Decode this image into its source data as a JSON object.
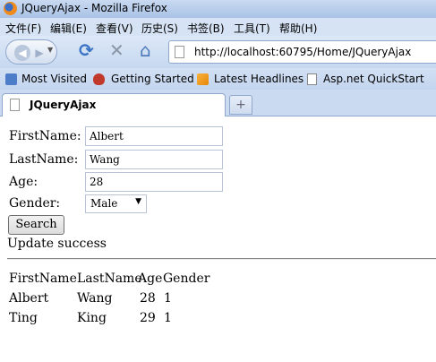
{
  "window": {
    "title": "JQueryAjax - Mozilla Firefox"
  },
  "menu": [
    "文件(F)",
    "编辑(E)",
    "查看(V)",
    "历史(S)",
    "书签(B)",
    "工具(T)",
    "帮助(H)"
  ],
  "nav": {
    "url": "http://localhost:60795/Home/JQueryAjax"
  },
  "bookmarks": [
    "Most Visited",
    "Getting Started",
    "Latest Headlines",
    "Asp.net QuickStart"
  ],
  "tab": {
    "label": "JQueryAjax",
    "new_tab_symbol": "+"
  },
  "form": {
    "firstname_label": "FirstName:",
    "firstname_value": "Albert",
    "lastname_label": "LastName:",
    "lastname_value": "Wang",
    "age_label": "Age:",
    "age_value": "28",
    "gender_label": "Gender:",
    "gender_value": "Male",
    "search_label": "Search"
  },
  "status": "Update success",
  "table": {
    "headers": [
      "FirstName",
      "LastName",
      "Age",
      "Gender"
    ],
    "rows": [
      [
        "Albert",
        "Wang",
        "28",
        "1"
      ],
      [
        "Ting",
        "King",
        "29",
        "1"
      ]
    ]
  }
}
